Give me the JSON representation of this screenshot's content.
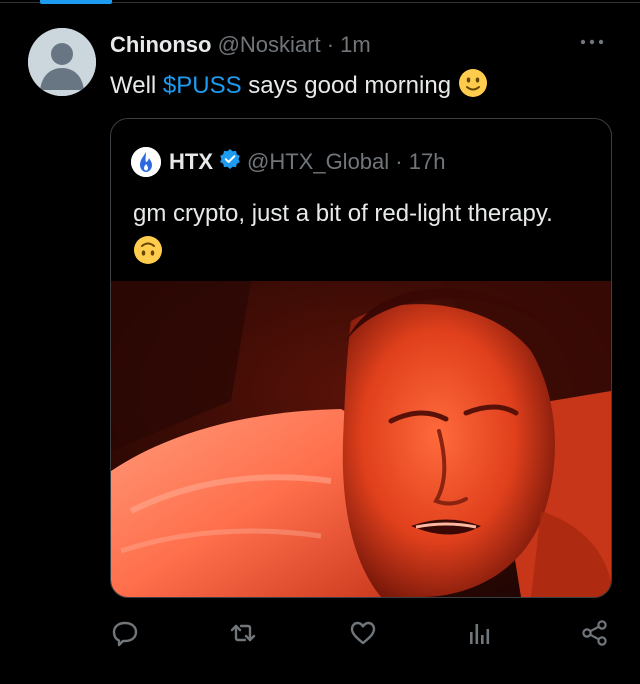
{
  "tweet": {
    "author_name": "Chinonso",
    "author_handle": "@Noskiart",
    "separator": "·",
    "time": "1m",
    "text_before": "Well ",
    "cashtag": "$PUSS",
    "text_after": " says good morning",
    "emoji": "slightly-smiling-face"
  },
  "quote": {
    "author_name": "HTX",
    "verified": true,
    "author_handle": "@HTX_Global",
    "separator": "·",
    "time": "17h",
    "text": "gm crypto, just a bit of red-light therapy.",
    "emoji": "upside-down-face",
    "media": "photo"
  },
  "actions": [
    {
      "name": "reply",
      "icon": "comment-icon"
    },
    {
      "name": "retweet",
      "icon": "retweet-icon"
    },
    {
      "name": "like",
      "icon": "heart-icon"
    },
    {
      "name": "views",
      "icon": "bar-chart-icon"
    },
    {
      "name": "share",
      "icon": "share-icon"
    }
  ],
  "colors": {
    "background": "#000000",
    "text": "#e7e9ea",
    "muted": "#71767b",
    "link": "#1d9bf0",
    "verified": "#1d9bf0",
    "emoji": "#ffcc4d"
  }
}
